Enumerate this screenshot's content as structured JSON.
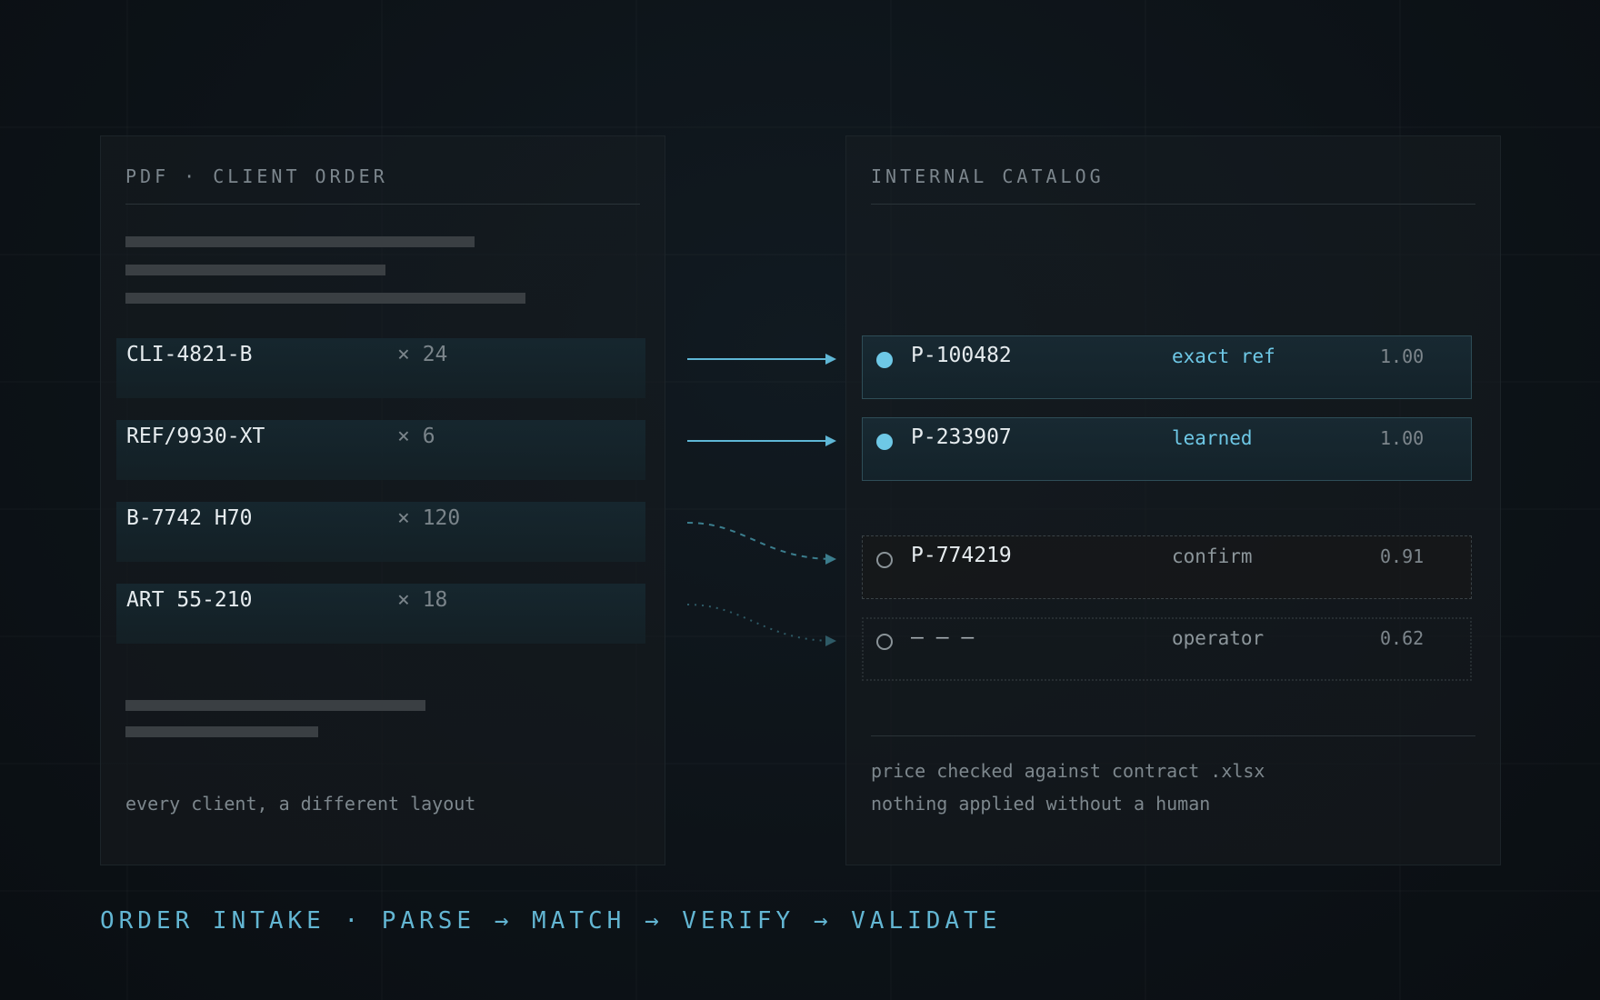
{
  "left_panel": {
    "title": "PDF · CLIENT ORDER",
    "rows": [
      {
        "code": "CLI-4821-B",
        "qty": "× 24"
      },
      {
        "code": "REF/9930-XT",
        "qty": "× 6"
      },
      {
        "code": "B-7742 H70",
        "qty": "× 120"
      },
      {
        "code": "ART 55-210",
        "qty": "× 18"
      }
    ],
    "note": "every client, a different layout"
  },
  "right_panel": {
    "title": "INTERNAL CATALOG",
    "matches": [
      {
        "product": "P-100482",
        "method": "exact ref",
        "score": "1.00",
        "status": "matched"
      },
      {
        "product": "P-233907",
        "method": "learned",
        "score": "1.00",
        "status": "matched"
      },
      {
        "product": "P-774219",
        "method": "confirm",
        "score": "0.91",
        "status": "needs-confirmation"
      },
      {
        "product": "— — —",
        "method": "operator",
        "score": "0.62",
        "status": "operator-review"
      }
    ],
    "note_lines": [
      "price checked against contract .xlsx",
      "nothing applied without a human"
    ]
  },
  "footer": "ORDER INTAKE · PARSE → MATCH → VERIFY → VALIDATE",
  "colors": {
    "accent": "#6ec8e6",
    "background": "#0d1318",
    "text": "#e6ecef",
    "muted": "#7d878d"
  }
}
